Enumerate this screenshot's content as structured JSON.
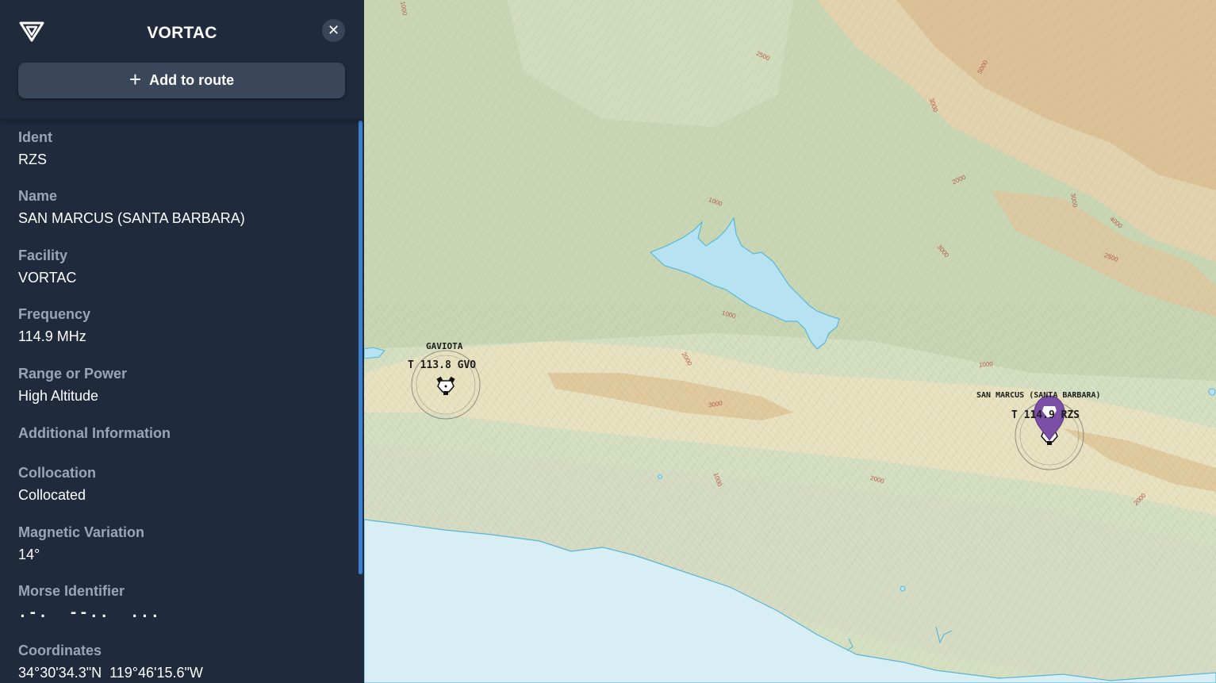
{
  "panel": {
    "title": "VORTAC",
    "logo_icon": "vortac-logo-icon",
    "close_icon": "close-icon",
    "add_route_label": "Add to route",
    "fields": [
      {
        "key": "Ident",
        "value": "RZS"
      },
      {
        "key": "Name",
        "value": "SAN MARCUS (SANTA BARBARA)"
      },
      {
        "key": "Facility",
        "value": "VORTAC"
      },
      {
        "key": "Frequency",
        "value": "114.9 MHz"
      },
      {
        "key": "Range or Power",
        "value": "High Altitude"
      },
      {
        "key": "Additional Information",
        "value": ""
      },
      {
        "key": "Collocation",
        "value": "Collocated"
      },
      {
        "key": "Magnetic Variation",
        "value": "14°"
      },
      {
        "key": "Morse Identifier",
        "value": ".-.  --..  ..."
      },
      {
        "key": "Coordinates",
        "value": "34°30'34.3\"N  119°46'15.6\"W"
      }
    ]
  },
  "map": {
    "colors": {
      "water": "#d7eef5",
      "lowland": "#d8e2c5",
      "valley": "#c9d8b6",
      "ridge": "#e9e3c4",
      "high": "#d9b98a",
      "contour_label": "#b55a4a"
    },
    "navaids": [
      {
        "name": "GAVIOTA",
        "freq_line": "T 113.8 GVO",
        "icon": "vortac-symbol-icon"
      },
      {
        "name": "SAN MARCUS (SANTA BARBARA)",
        "freq_line": "T 114.9 RZS",
        "icon": "vortac-symbol-icon",
        "selected": true,
        "marker_icon": "location-pin-icon"
      }
    ],
    "contour_labels": [
      "1000",
      "2500",
      "5000",
      "3000",
      "2000",
      "3000",
      "4000",
      "3000",
      "2500",
      "1000",
      "1000",
      "1000",
      "2000",
      "3000",
      "1000",
      "2000",
      "2000"
    ]
  }
}
